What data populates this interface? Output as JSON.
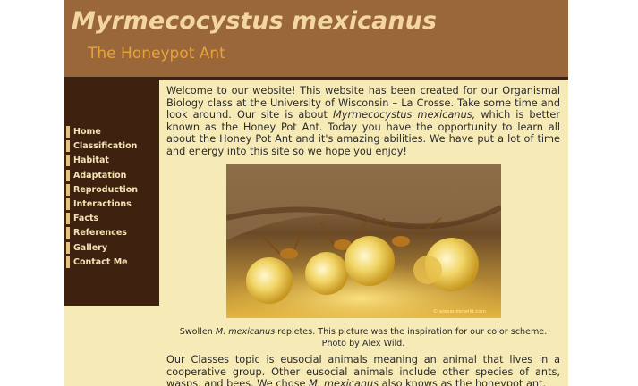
{
  "header": {
    "title": "Myrmecocystus mexicanus",
    "subtitle": "The Honeypot Ant"
  },
  "nav": {
    "items": [
      {
        "label": "Home"
      },
      {
        "label": "Classification"
      },
      {
        "label": "Habitat"
      },
      {
        "label": "Adaptation"
      },
      {
        "label": "Reproduction"
      },
      {
        "label": "Interactions"
      },
      {
        "label": "Facts"
      },
      {
        "label": "References"
      },
      {
        "label": "Gallery"
      },
      {
        "label": "Contact Me"
      }
    ]
  },
  "intro": {
    "part1": "Welcome to our website! This website has been created for our Organismal Biology class at the University of Wisconsin – La Crosse. Take some time and look around. Our site is about ",
    "species_italic": "Myrmecocystus mexicanus,",
    "part2": " which is better known as the Honey Pot Ant. Today you have the opportunity to learn all about the Honey Pot Ant and it's amazing abilities. We have put a lot of time and energy into this site so we hope you enjoy!"
  },
  "photo": {
    "caption_prefix": "Swollen ",
    "caption_italic": "M. mexicanus",
    "caption_suffix": " repletes. This picture was the inspiration for our color scheme. Photo by Alex Wild.",
    "watermark": "© alexanderwild.com"
  },
  "classes": {
    "part1": "Our Classes topic is eusocial animals meaning an animal that lives in a cooperative group. Other eusocial animals include other species of ants, wasps, and bees. We chose ",
    "species_italic": "M. mexicanus",
    "part2": " also knows as the honeypot ant."
  },
  "colors": {
    "page_bg": "#f6eab7",
    "header_bg": "#99673a",
    "sidebar_bg": "#3f2110",
    "nav_accent": "#e8c27a",
    "subtitle": "#e8a23a"
  }
}
